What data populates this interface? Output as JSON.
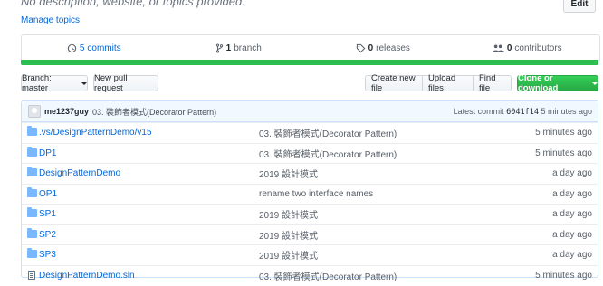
{
  "header": {
    "description": "No description, website, or topics provided.",
    "manage_topics": "Manage topics",
    "edit": "Edit"
  },
  "summary": {
    "commits": {
      "count": "5",
      "label": "commits"
    },
    "branches": {
      "count": "1",
      "label": "branch"
    },
    "releases": {
      "count": "0",
      "label": "releases"
    },
    "contributors": {
      "count": "0",
      "label": "contributors"
    }
  },
  "language_bar_color": "#2cbe4e",
  "toolbar": {
    "branch_label": "Branch: master",
    "new_pr": "New pull request",
    "create_file": "Create new file",
    "upload_files": "Upload files",
    "find_file": "Find file",
    "clone": "Clone or download"
  },
  "latest_commit": {
    "author": "me1237guy",
    "message": "03. 裝飾者模式(Decorator Pattern)",
    "label": "Latest commit",
    "sha": "6041f14",
    "age": "5 minutes ago"
  },
  "files": [
    {
      "type": "folder",
      "name": ".vs/DesignPatternDemo/v15",
      "message": "03. 裝飾者模式(Decorator Pattern)",
      "age": "5 minutes ago"
    },
    {
      "type": "folder",
      "name": "DP1",
      "message": "03. 裝飾者模式(Decorator Pattern)",
      "age": "5 minutes ago"
    },
    {
      "type": "folder",
      "name": "DesignPatternDemo",
      "message": "2019 設計模式",
      "age": "a day ago"
    },
    {
      "type": "folder",
      "name": "OP1",
      "message": "rename two interface names",
      "age": "a day ago"
    },
    {
      "type": "folder",
      "name": "SP1",
      "message": "2019 設計模式",
      "age": "a day ago"
    },
    {
      "type": "folder",
      "name": "SP2",
      "message": "2019 設計模式",
      "age": "a day ago"
    },
    {
      "type": "folder",
      "name": "SP3",
      "message": "2019 設計模式",
      "age": "a day ago"
    },
    {
      "type": "file",
      "name": "DesignPatternDemo.sln",
      "message": "03. 裝飾者模式(Decorator Pattern)",
      "age": "5 minutes ago"
    }
  ]
}
